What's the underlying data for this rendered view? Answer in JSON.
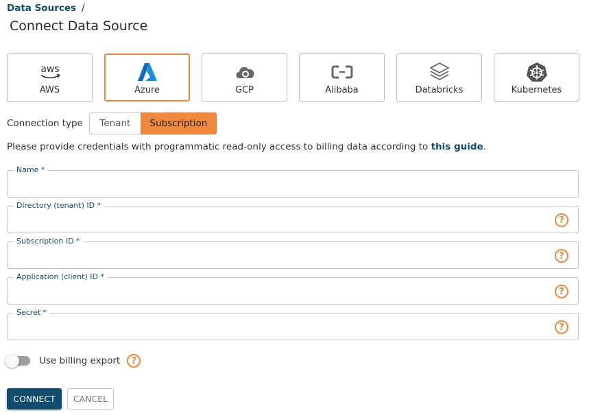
{
  "breadcrumb": {
    "link": "Data Sources",
    "separator": "/"
  },
  "page_title": "Connect Data Source",
  "providers": [
    {
      "label": "AWS",
      "icon": "aws-icon",
      "selected": false
    },
    {
      "label": "Azure",
      "icon": "azure-icon",
      "selected": true
    },
    {
      "label": "GCP",
      "icon": "gcp-icon",
      "selected": false
    },
    {
      "label": "Alibaba",
      "icon": "alibaba-icon",
      "selected": false
    },
    {
      "label": "Databricks",
      "icon": "databricks-icon",
      "selected": false
    },
    {
      "label": "Kubernetes",
      "icon": "kubernetes-icon",
      "selected": false
    }
  ],
  "aws_logo_text": "aws",
  "connection": {
    "label": "Connection type",
    "options": [
      "Tenant",
      "Subscription"
    ],
    "selected": "Subscription"
  },
  "info": {
    "text": "Please provide credentials with programmatic read-only access to billing data according to ",
    "link": "this guide",
    "suffix": "."
  },
  "fields": [
    {
      "label": "Name *",
      "value": "",
      "help": false
    },
    {
      "label": "Directory (tenant) ID *",
      "value": "",
      "help": true
    },
    {
      "label": "Subscription ID *",
      "value": "",
      "help": true
    },
    {
      "label": "Application (client) ID *",
      "value": "",
      "help": true
    },
    {
      "label": "Secret *",
      "value": "",
      "help": true
    }
  ],
  "help_glyph": "?",
  "billing_export": {
    "label": "Use billing export",
    "enabled": false
  },
  "buttons": {
    "connect": "CONNECT",
    "cancel": "CANCEL"
  },
  "colors": {
    "accent": "#f0883d",
    "primary": "#0f4c6e"
  }
}
